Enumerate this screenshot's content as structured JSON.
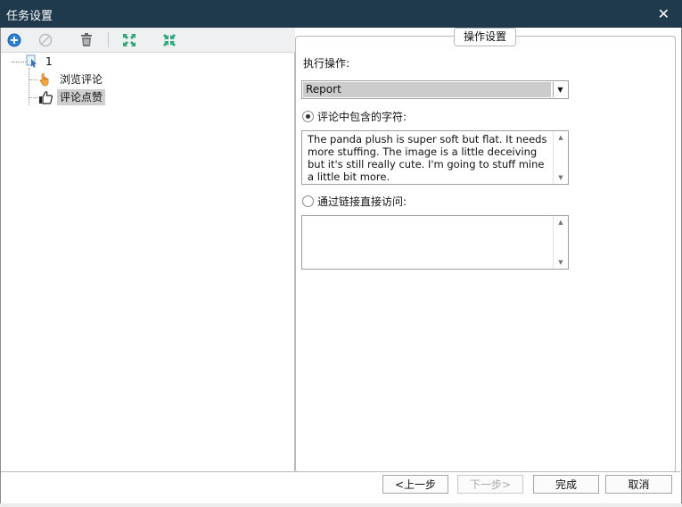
{
  "window": {
    "title": "任务设置"
  },
  "toolbar": {
    "icons": [
      "add-icon",
      "disabled-icon",
      "delete-icon",
      "expand-icon",
      "collapse-icon"
    ]
  },
  "tree": {
    "root": "1",
    "items": [
      {
        "label": "浏览评论",
        "icon": "hand-cursor-icon"
      },
      {
        "label": "评论点赞",
        "icon": "thumbs-up-icon",
        "selected": true
      }
    ]
  },
  "panel": {
    "title": "操作设置",
    "action_label": "执行操作:",
    "action_value": "Report",
    "option1_label": "评论中包含的字符:",
    "option1_text": "The panda plush is super soft but flat. It needs more stuffing. The image is a little deceiving but it's still really cute. I'm going to stuff mine a little bit more.",
    "option2_label": "通过链接直接访问:",
    "option2_text": ""
  },
  "buttons": {
    "prev": "<上一步",
    "next": "下一步>",
    "finish": "完成",
    "cancel": "取消"
  },
  "colors": {
    "titlebar": "#1f3a4c",
    "add": "#1a73c8",
    "expand": "#2aa876"
  }
}
